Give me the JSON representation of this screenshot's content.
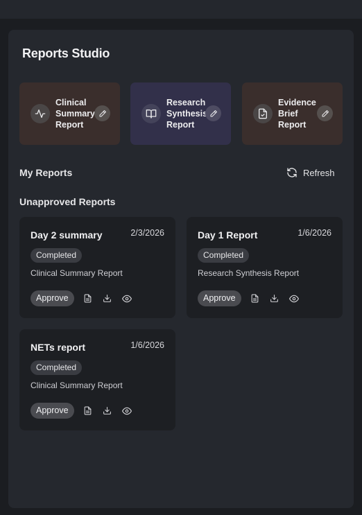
{
  "page": {
    "title": "Reports Studio"
  },
  "templates": [
    {
      "label": "Clinical Summary Report",
      "icon": "activity-icon",
      "color": "#3a2e2c"
    },
    {
      "label": "Research Synthesis Report",
      "icon": "book-open-icon",
      "color": "#32304a"
    },
    {
      "label": "Evidence Brief Report",
      "icon": "file-check-icon",
      "color": "#3a2e2c"
    }
  ],
  "my_reports": {
    "title": "My Reports",
    "refresh_label": "Refresh"
  },
  "unapproved": {
    "title": "Unapproved Reports",
    "reports": [
      {
        "title": "Day 2 summary",
        "date": "2/3/2026",
        "status": "Completed",
        "type": "Clinical Summary Report",
        "approve_label": "Approve"
      },
      {
        "title": "Day 1 Report",
        "date": "1/6/2026",
        "status": "Completed",
        "type": "Research Synthesis Report",
        "approve_label": "Approve"
      },
      {
        "title": "NETs report",
        "date": "1/6/2026",
        "status": "Completed",
        "type": "Clinical Summary Report",
        "approve_label": "Approve"
      }
    ]
  }
}
